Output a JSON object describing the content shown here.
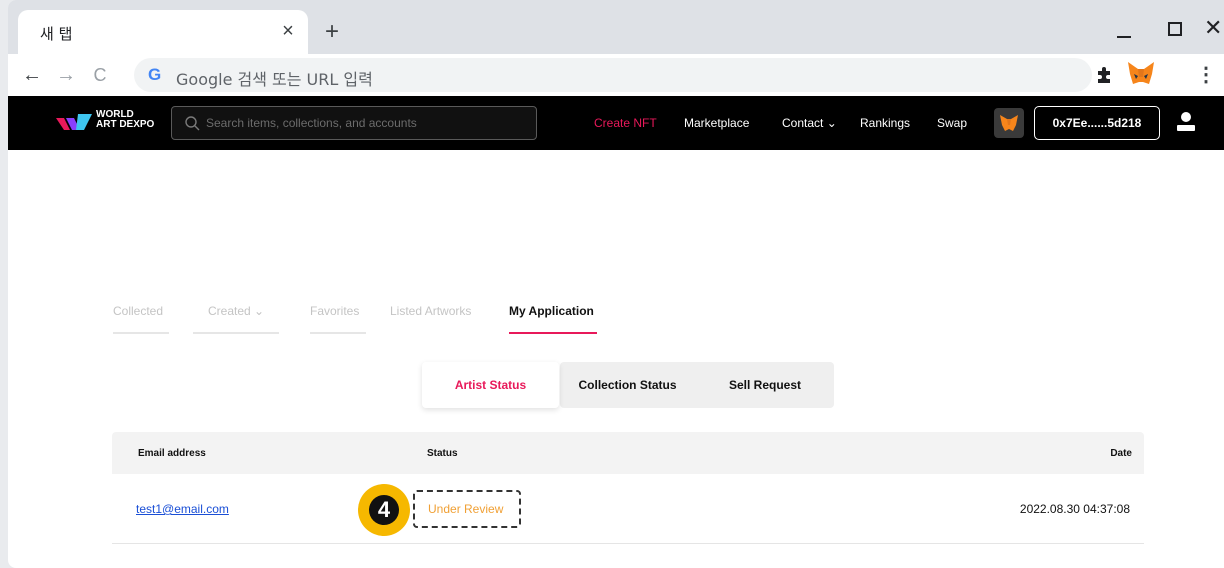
{
  "browser": {
    "tab_title": "새 탭",
    "tab_close": "×",
    "new_tab": "+",
    "back": "←",
    "forward": "→",
    "reload": "C",
    "google_g": "G",
    "omnibox_placeholder": "Google 검색 또는 URL 입력",
    "window_close": "✕",
    "menu": "⋮"
  },
  "site": {
    "logo_line1": "WORLD",
    "logo_line2": "ART DEXPO",
    "search_placeholder": "Search items, collections, and accounts",
    "nav": {
      "create_nft": "Create NFT",
      "marketplace": "Marketplace",
      "contact": "Contact ⌄",
      "rankings": "Rankings",
      "swap": "Swap"
    },
    "wallet_address": "0x7Ee......5d218",
    "accent_color": "#e8195a"
  },
  "profile_tabs": {
    "collected": "Collected",
    "created": "Created ⌄",
    "favorites": "Favorites",
    "listed": "Listed Artworks",
    "my_application": "My Application"
  },
  "status_tabs": {
    "artist": "Artist Status",
    "collection": "Collection Status",
    "sell": "Sell Request"
  },
  "table": {
    "headers": {
      "email": "Email address",
      "status": "Status",
      "date": "Date"
    },
    "row": {
      "email": "test1@email.com",
      "status": "Under Review",
      "date": "2022.08.30 04:37:08"
    }
  },
  "annotation": {
    "step": "4"
  }
}
